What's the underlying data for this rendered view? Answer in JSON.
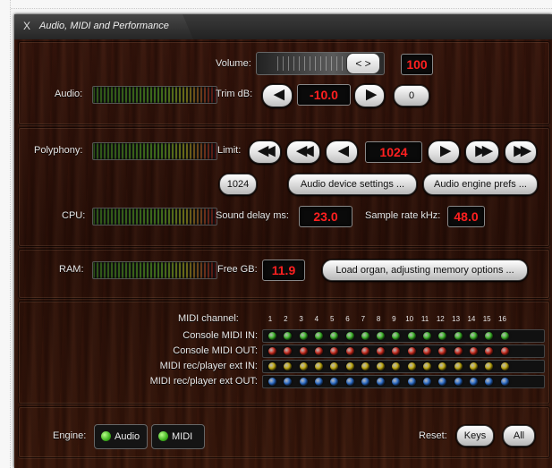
{
  "window": {
    "title": "Audio, MIDI and Performance",
    "close_glyph": "X"
  },
  "audio": {
    "label": "Audio:",
    "volume_label": "Volume:",
    "volume_knob": "< >",
    "volume_value": "100",
    "trim_label": "Trim dB:",
    "trim_value": "-10.0",
    "trim_reset": "0"
  },
  "polyphony": {
    "label": "Polyphony:",
    "limit_label": "Limit:",
    "limit_value": "1024",
    "preset_button": "1024",
    "audio_device_button": "Audio device settings ...",
    "audio_engine_button": "Audio engine prefs ..."
  },
  "cpu": {
    "label": "CPU:",
    "sound_delay_label": "Sound delay ms:",
    "sound_delay_value": "23.0",
    "sample_rate_label": "Sample rate kHz:",
    "sample_rate_value": "48.0"
  },
  "ram": {
    "label": "RAM:",
    "free_label": "Free GB:",
    "free_value": "11.9",
    "load_button": "Load organ, adjusting memory options ..."
  },
  "midi": {
    "channel_label": "MIDI channel:",
    "channels": [
      "1",
      "2",
      "3",
      "4",
      "5",
      "6",
      "7",
      "8",
      "9",
      "10",
      "11",
      "12",
      "13",
      "14",
      "15",
      "16"
    ],
    "rows": [
      {
        "label": "Console MIDI IN:",
        "color": "#3fbf2a"
      },
      {
        "label": "Console MIDI OUT:",
        "color": "#d12a1c"
      },
      {
        "label": "MIDI rec/player ext IN:",
        "color": "#c9b20f"
      },
      {
        "label": "MIDI rec/player ext OUT:",
        "color": "#2a6fd1"
      }
    ]
  },
  "engine": {
    "label": "Engine:",
    "audio_button": "Audio",
    "midi_button": "MIDI",
    "reset_label": "Reset:",
    "keys_button": "Keys",
    "all_button": "All"
  }
}
